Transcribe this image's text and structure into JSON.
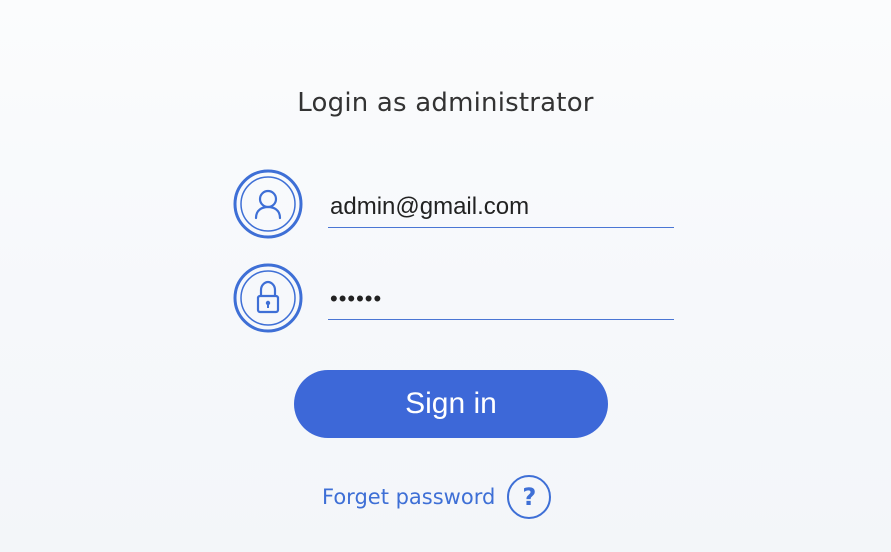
{
  "login": {
    "title": "Login as administrator",
    "email": {
      "value": "admin@gmail.com",
      "icon": "user-icon"
    },
    "password": {
      "value": "••••••",
      "icon": "lock-icon"
    },
    "sign_in_label": "Sign in",
    "forget_password_label": "Forget password",
    "help_icon_glyph": "?"
  },
  "colors": {
    "accent": "#3d68d8",
    "link": "#3e6fd6",
    "background": "#f8fafc"
  }
}
